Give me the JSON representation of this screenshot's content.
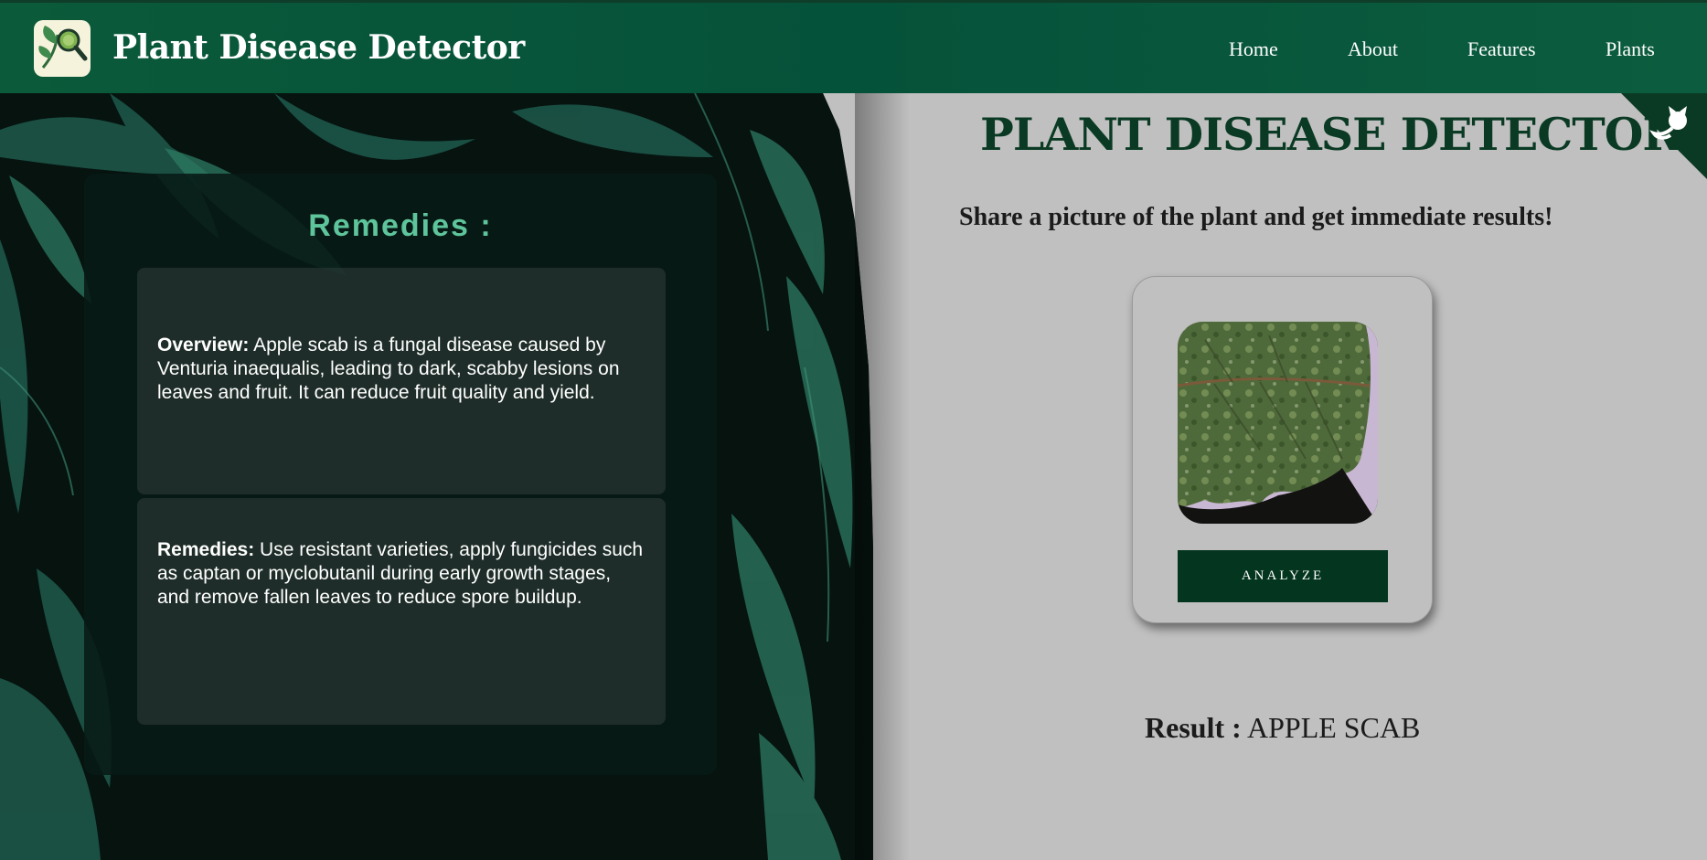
{
  "header": {
    "logo_icon": "leaf-magnifier-icon",
    "brand": "Plant Disease Detector",
    "nav": [
      "Home",
      "About",
      "Features",
      "Plants"
    ]
  },
  "remedies": {
    "title": "Remedies :",
    "overview_label": "Overview:",
    "overview_text": " Apple scab is a fungal disease caused by Venturia inaequalis, leading to dark, scabby lesions on leaves and fruit. It can reduce fruit quality and yield.",
    "remedies_label": "Remedies:",
    "remedies_text": " Use resistant varieties, apply fungicides such as captan or myclobutanil during early growth stages, and remove fallen leaves to reduce spore buildup."
  },
  "main": {
    "title": "PLANT DISEASE DETECTOR",
    "subtitle": "Share a picture of the plant and get immediate results!",
    "corner_icon": "github-octocat-icon",
    "upload_image": "apple-scab-leaf-image",
    "analyze_label": "ANALYZE",
    "result_label": "Result :",
    "result_value": " APPLE SCAB"
  },
  "colors": {
    "header_bg": "#05523a",
    "accent_dark": "#04351f",
    "remedies_title": "#5ec49b",
    "page_bg": "#c0c0c0"
  }
}
